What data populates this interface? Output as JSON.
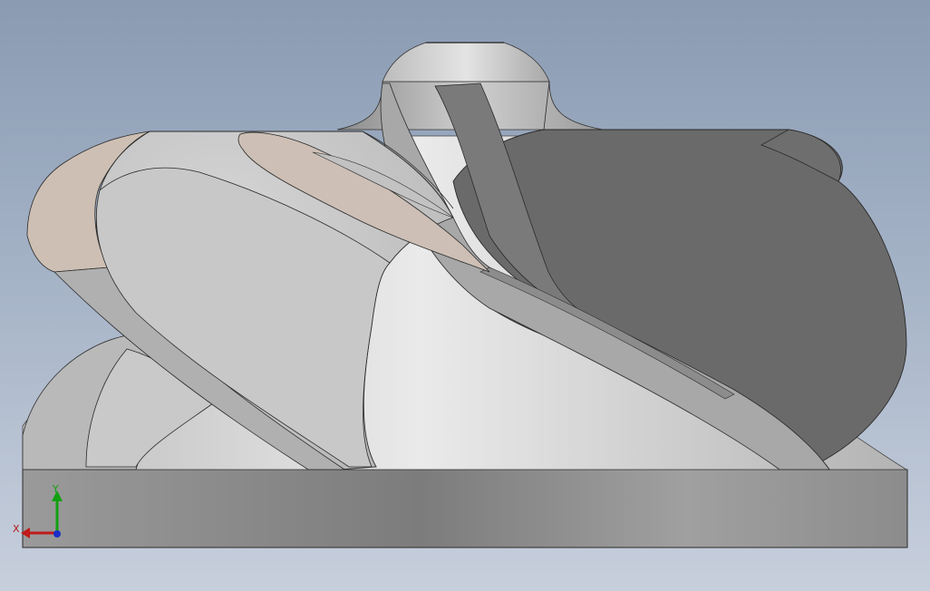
{
  "triad": {
    "x_label": "X",
    "y_label": "Y",
    "x_color": "#c01a1a",
    "y_color": "#12a012",
    "z_color": "#1a2ec8"
  },
  "viewport": {
    "background_top": "#8a9bb2",
    "background_bottom": "#c7cfdc",
    "view": "front",
    "model": "impeller"
  }
}
